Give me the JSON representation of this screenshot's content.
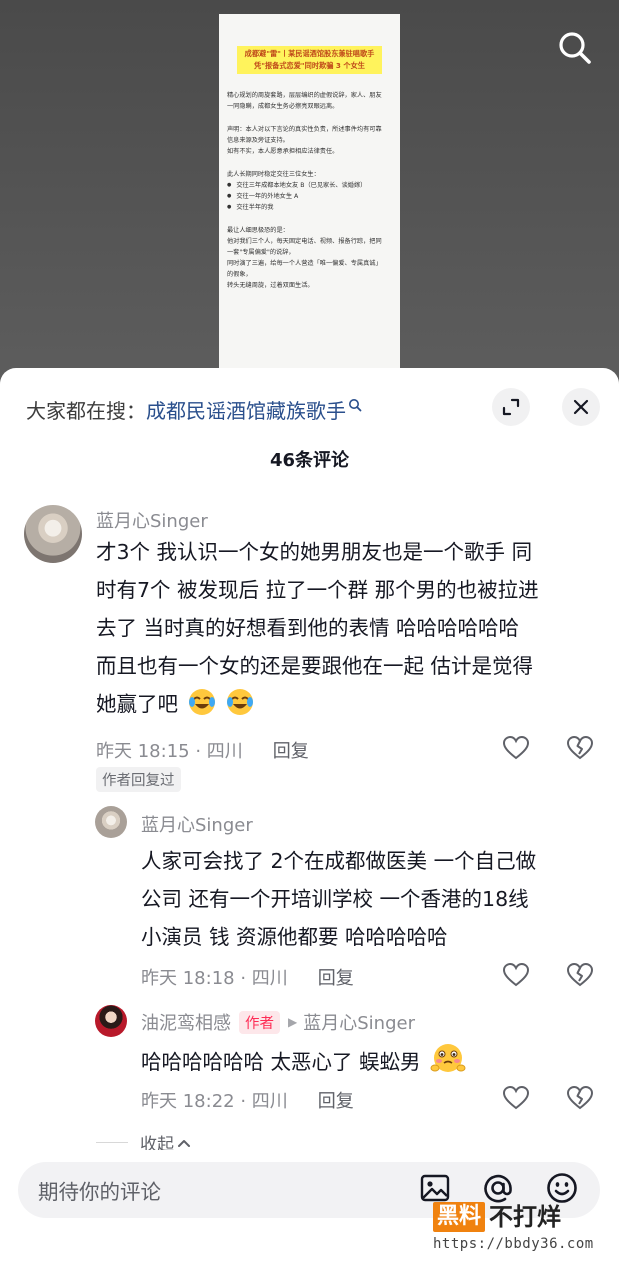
{
  "video": {
    "doc": {
      "title_lines": [
        "成都避\"雷\"丨某民谣酒馆股东兼驻唱歌手",
        "凭\"报备式恋爱\"同时欺骗 3 个女生"
      ],
      "intro_lines": [
        "精心规划的周旋套路，层层编织的虚假说辞，家人、朋友",
        "一同隐瞒，成都女生务必擦亮双眼远离。"
      ],
      "statement_lines": [
        "声明：本人对以下言论的真实性负责，所述事件均有可靠",
        "信息来源及旁证支持。",
        "如有不实，本人愿意承担相应法律责任。"
      ],
      "list_intro": "此人长期同时稳定交往三位女生：",
      "list_items": [
        "交往三年成都本地女友 B（已见家长、谈婚嫁）",
        "交往一年的外地女生 A",
        "交往半年的我"
      ],
      "ending_lines": [
        "最让人细思极恐的是：",
        "他对我们三个人，每天固定电话、视频、报备行踪，把同",
        "一套\"专属偏爱\"的说辞，",
        "同时演了三遍，给每一个人营造「唯一偏爱、专属真诚」",
        "的假象，",
        "转头无缝周旋，过着双面生活。"
      ]
    }
  },
  "sheet": {
    "hot_search_label": "大家都在搜：",
    "hot_search_keyword": "成都民谣酒馆藏族歌手",
    "comment_count": "46条评论"
  },
  "comments": [
    {
      "username": "蓝月心Singer",
      "lines": [
        "才3个 我认识一个女的她男朋友也是一个歌手 同",
        "时有7个 被发现后 拉了一个群 那个男的也被拉进",
        "去了 当时真的好想看到他的表情 哈哈哈哈哈哈",
        "而且也有一个女的还是要跟他在一起 估计是觉得",
        "她赢了吧"
      ],
      "time_location": "昨天 18:15 · 四川",
      "reply_label": "回复",
      "author_replied": "作者回复过"
    },
    {
      "username": "蓝月心Singer",
      "lines": [
        "人家可会找了 2个在成都做医美 一个自己做",
        "公司 还有一个开培训学校 一个香港的18线",
        "小演员 钱 资源他都要 哈哈哈哈哈"
      ],
      "time_location": "昨天 18:18 · 四川",
      "reply_label": "回复"
    },
    {
      "username": "油泥鸾相感",
      "author_badge": "作者",
      "reply_to": "蓝月心Singer",
      "lines": [
        "哈哈哈哈哈哈 太恶心了 蜈蚣男"
      ],
      "time_location": "昨天 18:22 · 四川",
      "reply_label": "回复"
    }
  ],
  "collapse_label": "收起",
  "input": {
    "placeholder": "期待你的评论"
  },
  "watermark": {
    "part1": "黑料",
    "part2": "不打烊",
    "url": "https://bbdy36.com"
  },
  "colors": {
    "accent": "#fe2c55",
    "keyword_link": "#2a4f8c",
    "meta_gray": "#8a8b91"
  }
}
